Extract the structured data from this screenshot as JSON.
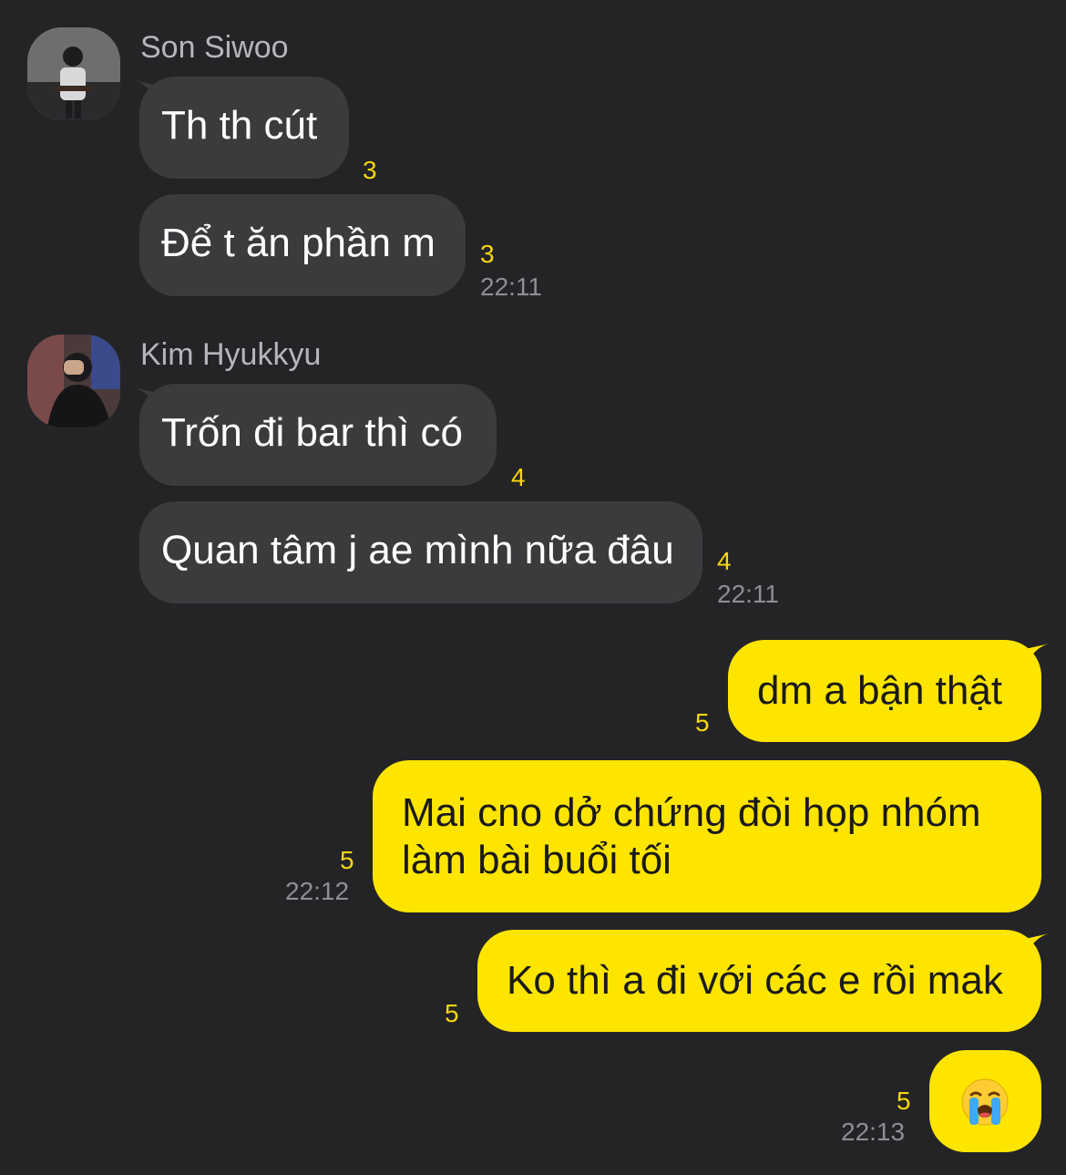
{
  "colors": {
    "background": "#242426",
    "incoming_bubble": "#3b3b3e",
    "outgoing_bubble": "#fee500",
    "unread_count": "#f7d70f",
    "timestamp": "#8e8e93"
  },
  "groups": [
    {
      "sender": "Son Siwoo",
      "avatar": "user-avatar",
      "messages": [
        {
          "text": "Th th cút",
          "unread": "3"
        },
        {
          "text": "Để t ăn phần m",
          "unread": "3",
          "time": "22:11"
        }
      ]
    },
    {
      "sender": "Kim Hyukkyu",
      "avatar": "user-avatar",
      "messages": [
        {
          "text": "Trốn đi bar thì có",
          "unread": "4"
        },
        {
          "text": "Quan tâm j ae mình nữa đâu",
          "unread": "4",
          "time": "22:11"
        }
      ]
    }
  ],
  "outgoing": [
    {
      "lines": [
        "dm a bận thật"
      ],
      "unread": "5"
    },
    {
      "lines": [
        "Mai cno dở chứng đòi họp nhóm",
        "làm bài buổi tối"
      ],
      "unread": "5",
      "time": "22:12"
    },
    {
      "lines": [
        "Ko thì a đi với các e rồi mak"
      ],
      "unread": "5"
    },
    {
      "emoji": "loudly-crying-face-icon",
      "unread": "5",
      "time": "22:13"
    }
  ]
}
